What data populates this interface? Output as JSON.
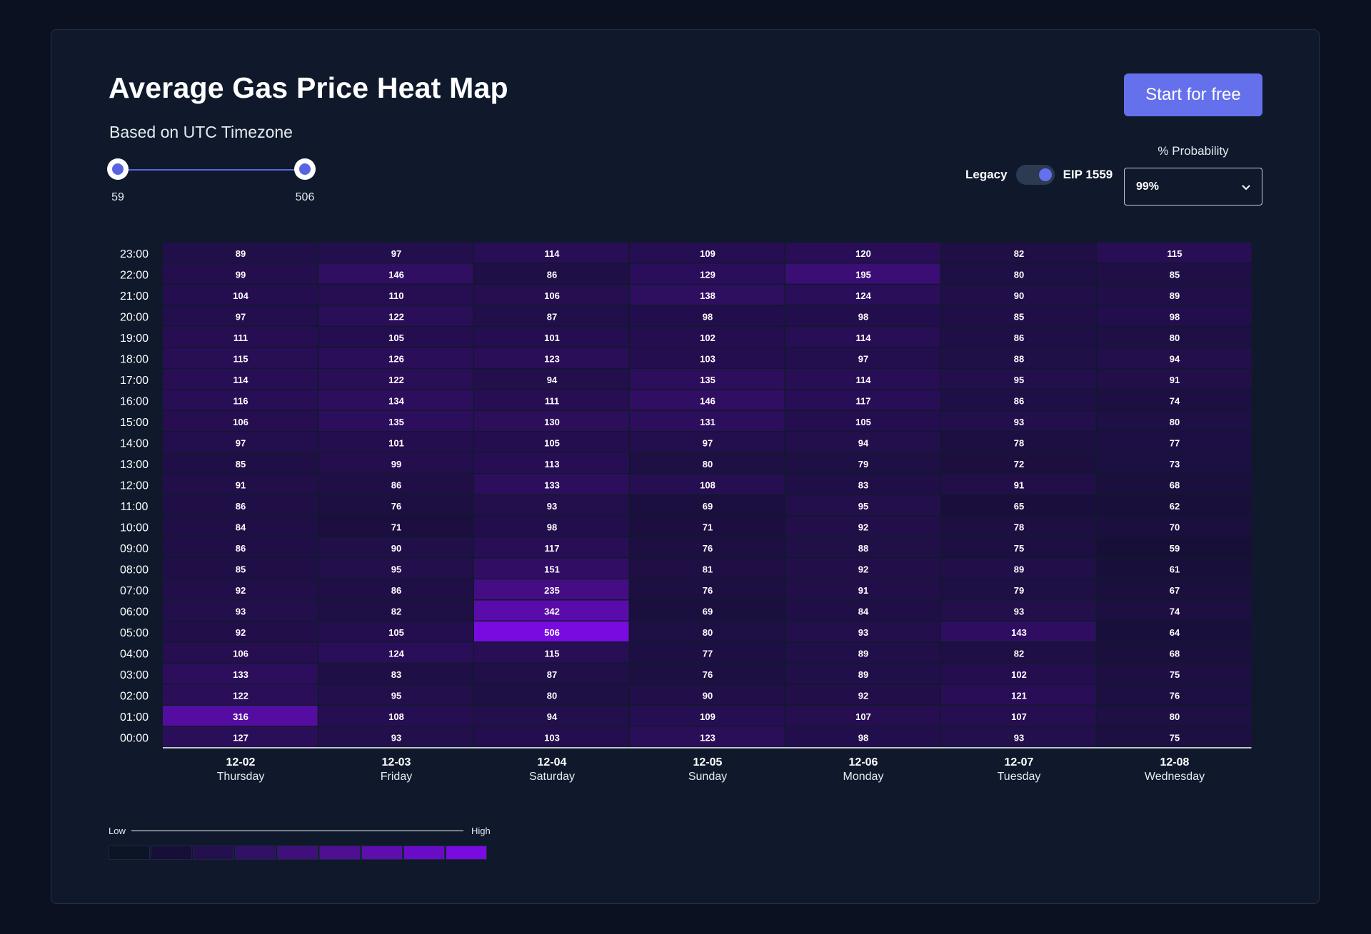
{
  "header": {
    "title": "Average Gas Price Heat Map",
    "subtitle": "Based on UTC Timezone",
    "cta_label": "Start for free"
  },
  "range_slider": {
    "min_label": "59",
    "max_label": "506"
  },
  "toggle": {
    "left_label": "Legacy",
    "right_label": "EIP 1559",
    "selected": "EIP 1559"
  },
  "probability": {
    "label": "% Probability",
    "selected": "99%"
  },
  "legend": {
    "low_label": "Low",
    "high_label": "High",
    "colors": [
      "#0c1425",
      "#170f38",
      "#25104f",
      "#311165",
      "#3f1079",
      "#4e0f93",
      "#5d0ead",
      "#6a0cc7",
      "#7a0be0"
    ]
  },
  "colors": {
    "accent": "#6470ec",
    "heat_low": "#170f38",
    "heat_high": "#7a0be0"
  },
  "chart_data": {
    "type": "heatmap",
    "title": "Average Gas Price Heat Map",
    "x": [
      {
        "date": "12-02",
        "day": "Thursday"
      },
      {
        "date": "12-03",
        "day": "Friday"
      },
      {
        "date": "12-04",
        "day": "Saturday"
      },
      {
        "date": "12-05",
        "day": "Sunday"
      },
      {
        "date": "12-06",
        "day": "Monday"
      },
      {
        "date": "12-07",
        "day": "Tuesday"
      },
      {
        "date": "12-08",
        "day": "Wednesday"
      }
    ],
    "y": [
      "23:00",
      "22:00",
      "21:00",
      "20:00",
      "19:00",
      "18:00",
      "17:00",
      "16:00",
      "15:00",
      "14:00",
      "13:00",
      "12:00",
      "11:00",
      "10:00",
      "09:00",
      "08:00",
      "07:00",
      "06:00",
      "05:00",
      "04:00",
      "03:00",
      "02:00",
      "01:00",
      "00:00"
    ],
    "values": [
      [
        89,
        97,
        114,
        109,
        120,
        82,
        115
      ],
      [
        99,
        146,
        86,
        129,
        195,
        80,
        85
      ],
      [
        104,
        110,
        106,
        138,
        124,
        90,
        89
      ],
      [
        97,
        122,
        87,
        98,
        98,
        85,
        98
      ],
      [
        111,
        105,
        101,
        102,
        114,
        86,
        80
      ],
      [
        115,
        126,
        123,
        103,
        97,
        88,
        94
      ],
      [
        114,
        122,
        94,
        135,
        114,
        95,
        91
      ],
      [
        116,
        134,
        111,
        146,
        117,
        86,
        74
      ],
      [
        106,
        135,
        130,
        131,
        105,
        93,
        80
      ],
      [
        97,
        101,
        105,
        97,
        94,
        78,
        77
      ],
      [
        85,
        99,
        113,
        80,
        79,
        72,
        73
      ],
      [
        91,
        86,
        133,
        108,
        83,
        91,
        68
      ],
      [
        86,
        76,
        93,
        69,
        95,
        65,
        62
      ],
      [
        84,
        71,
        98,
        71,
        92,
        78,
        70
      ],
      [
        86,
        90,
        117,
        76,
        88,
        75,
        59
      ],
      [
        85,
        95,
        151,
        81,
        92,
        89,
        61
      ],
      [
        92,
        86,
        235,
        76,
        91,
        79,
        67
      ],
      [
        93,
        82,
        342,
        69,
        84,
        93,
        74
      ],
      [
        92,
        105,
        506,
        80,
        93,
        143,
        64
      ],
      [
        106,
        124,
        115,
        77,
        89,
        82,
        68
      ],
      [
        133,
        83,
        87,
        76,
        89,
        102,
        75
      ],
      [
        122,
        95,
        80,
        90,
        92,
        121,
        76
      ],
      [
        316,
        108,
        94,
        109,
        107,
        107,
        80
      ],
      [
        127,
        93,
        103,
        123,
        98,
        93,
        75
      ]
    ],
    "range": [
      59,
      506
    ],
    "grid": true,
    "legend": "bottom-left"
  }
}
